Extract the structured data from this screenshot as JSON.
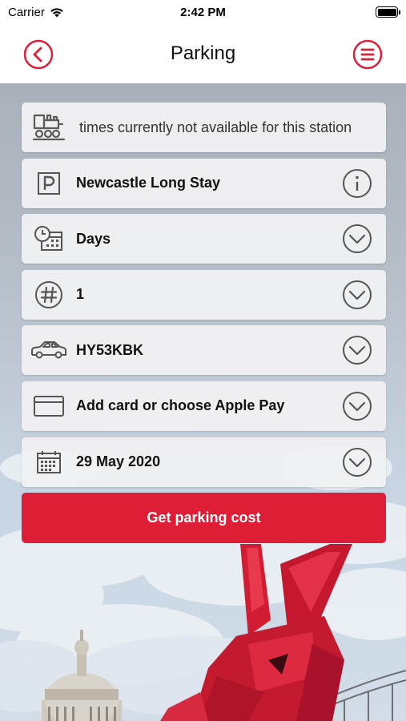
{
  "status_bar": {
    "carrier": "Carrier",
    "time": "2:42 PM"
  },
  "nav": {
    "title": "Parking"
  },
  "colors": {
    "accent": "#dd1e36",
    "row_bg": "#f0f0f2"
  },
  "rows": {
    "info": {
      "text": "s times currently not available for this station",
      "icon": "train-icon"
    },
    "car_park": {
      "text": "Newcastle Long Stay",
      "icon": "parking-icon",
      "action": "info-icon"
    },
    "duration_unit": {
      "text": "Days",
      "icon": "clock-calendar-icon",
      "action": "chevron-down-icon"
    },
    "quantity": {
      "text": "1",
      "icon": "hash-icon",
      "action": "chevron-down-icon"
    },
    "vehicle": {
      "text": "HY53KBK",
      "icon": "car-icon",
      "action": "chevron-down-icon"
    },
    "payment": {
      "text": "Add card or choose Apple Pay",
      "icon": "credit-card-icon",
      "action": "chevron-down-icon"
    },
    "date": {
      "text": "29 May 2020",
      "icon": "calendar-icon",
      "action": "chevron-down-icon"
    }
  },
  "cta": {
    "label": "Get parking cost"
  }
}
